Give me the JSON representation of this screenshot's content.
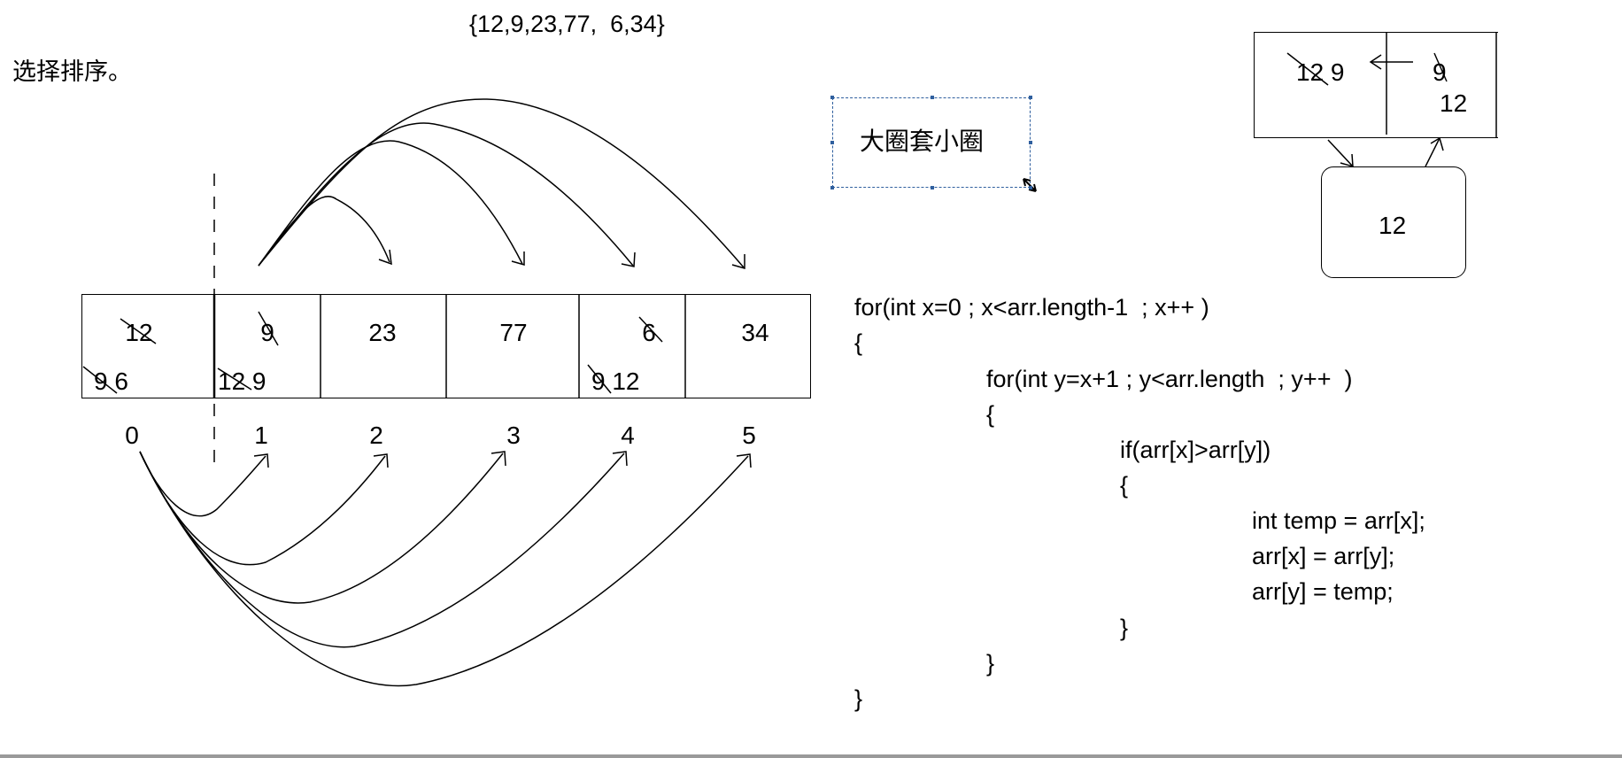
{
  "header": {
    "array_literal": "{12,9,23,77,  6,34}",
    "title": "选择排序。"
  },
  "array": {
    "cells": [
      {
        "top": "12",
        "bottom": "9  6"
      },
      {
        "top": "9",
        "bottom": "12  9"
      },
      {
        "top": "23",
        "bottom": ""
      },
      {
        "top": "77",
        "bottom": ""
      },
      {
        "top": "6",
        "bottom": "9 12"
      },
      {
        "top": "34",
        "bottom": ""
      }
    ],
    "indices": [
      "0",
      "1",
      "2",
      "3",
      "4",
      "5"
    ]
  },
  "note": {
    "label": "大圈套小圈"
  },
  "swap_diagram": {
    "left_cell": "12  9",
    "right_cell_top": "9",
    "right_cell_bottom": "12",
    "temp_value": "12"
  },
  "code": {
    "lines": [
      "for(int x=0 ; x<arr.length-1  ; x++ )",
      "{",
      "for(int y=x+1 ; y<arr.length  ; y++  )",
      "{",
      "if(arr[x]>arr[y])",
      "{",
      "int temp = arr[x];",
      "arr[x] = arr[y];",
      "arr[y] = temp;",
      "}",
      "}",
      "}"
    ]
  },
  "colors": {
    "ink": "#000000",
    "textbox_border": "#2f5f9e",
    "bottom_bar": "#9a9a9a"
  }
}
